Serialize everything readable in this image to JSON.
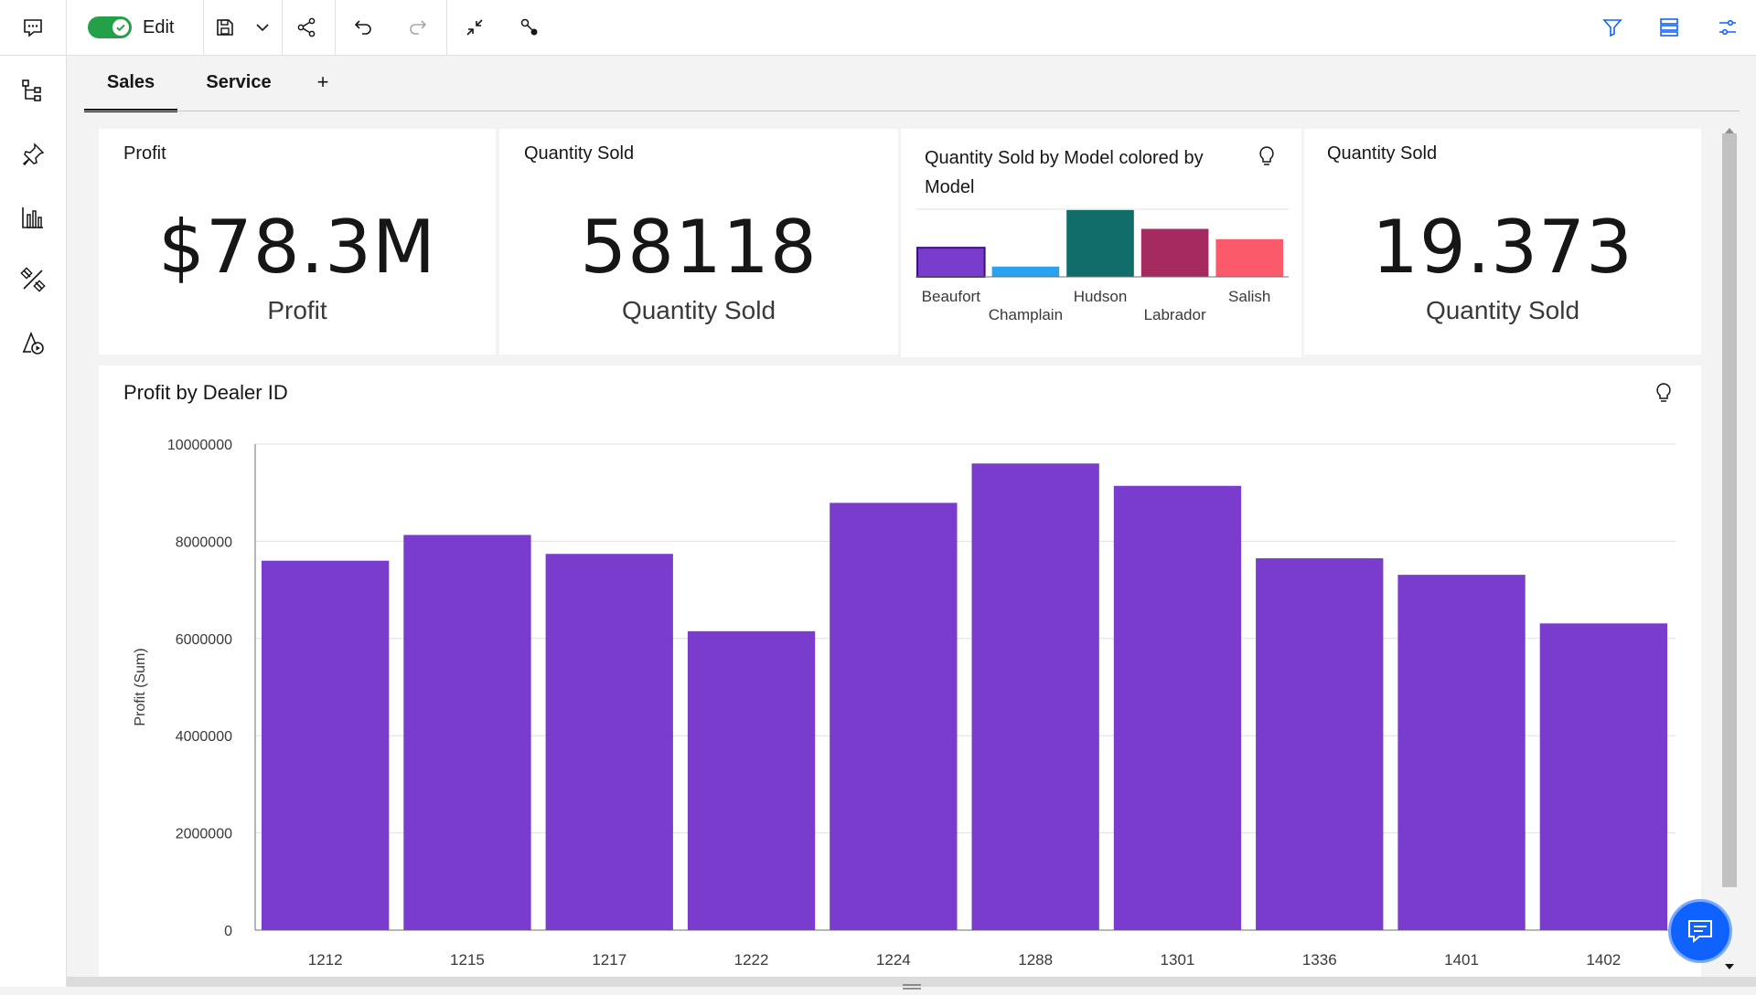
{
  "toolbar": {
    "edit_label": "Edit"
  },
  "tabs": [
    {
      "label": "Sales",
      "active": true
    },
    {
      "label": "Service",
      "active": false
    }
  ],
  "add_tab_label": "+",
  "widgets": {
    "profit": {
      "title": "Profit",
      "value": "$78.3M",
      "label": "Profit"
    },
    "quantity": {
      "title": "Quantity Sold",
      "value": "58118",
      "label": "Quantity Sold"
    },
    "model_chart": {
      "title_line1": "Quantity Sold by Model colored by",
      "title_line2": "Model"
    },
    "quantity2": {
      "title": "Quantity Sold",
      "value": "19.373",
      "label": "Quantity Sold"
    },
    "dealer_chart": {
      "title": "Profit by Dealer ID"
    }
  },
  "colors": {
    "accent": "#0f62fe",
    "toggle_on": "#24a148",
    "bar_purple": "#7a3ccd"
  },
  "chart_data": [
    {
      "type": "bar",
      "title": "Quantity Sold by Model colored by Model",
      "categories": [
        "Beaufort",
        "Champlain",
        "Hudson",
        "Labrador",
        "Salish"
      ],
      "values": [
        8.5,
        3,
        19.5,
        14,
        11
      ],
      "colors": [
        "#7a3ccd",
        "#29a3f0",
        "#106d6a",
        "#a52a60",
        "#fa5a6a"
      ],
      "ylim": [
        0,
        20
      ],
      "grid": false
    },
    {
      "type": "bar",
      "title": "Profit by Dealer ID",
      "xlabel": "",
      "ylabel": "Profit (Sum)",
      "categories": [
        "1212",
        "1215",
        "1217",
        "1222",
        "1224",
        "1288",
        "1301",
        "1336",
        "1401",
        "1402"
      ],
      "values": [
        7600000,
        8130000,
        7740000,
        6150000,
        8790000,
        9600000,
        9140000,
        7650000,
        7310000,
        6310000
      ],
      "ylim": [
        0,
        10000000
      ],
      "yticks": [
        "0",
        "2000000",
        "4000000",
        "6000000",
        "8000000",
        "10000000"
      ],
      "grid": true
    }
  ]
}
